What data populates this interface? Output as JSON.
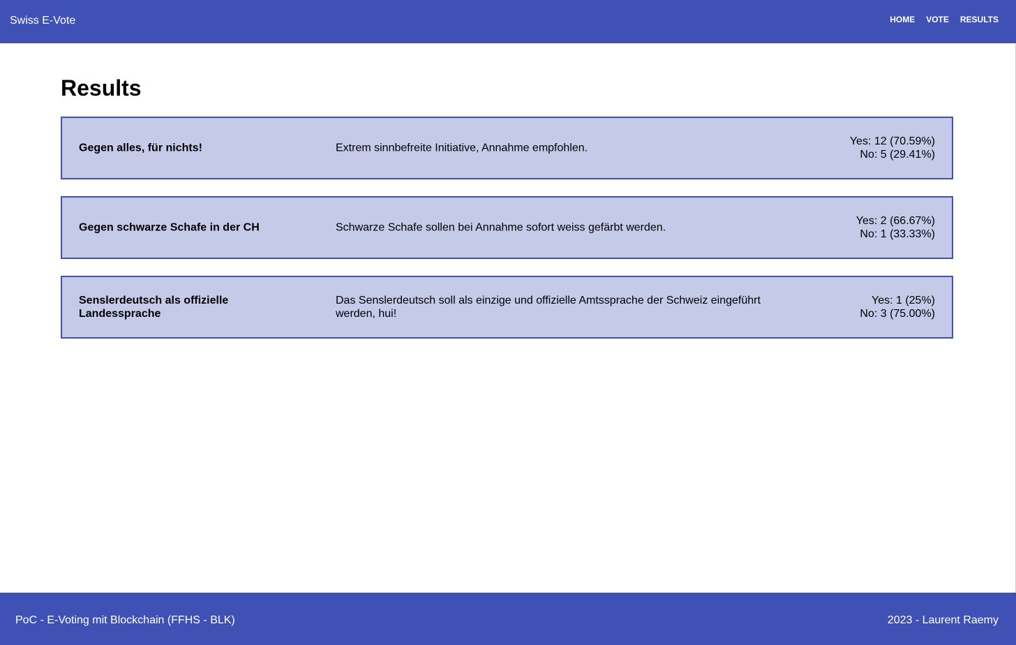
{
  "app": {
    "title": "Swiss E-Vote"
  },
  "nav": {
    "items": [
      {
        "label": "HOME"
      },
      {
        "label": "VOTE"
      },
      {
        "label": "RESULTS"
      }
    ]
  },
  "main": {
    "title": "Results",
    "results": [
      {
        "title": "Gegen alles, für nichts!",
        "description": "Extrem sinnbefreite Initiative, Annahme empfohlen.",
        "yes": "Yes: 12 (70.59%)",
        "no": "No: 5 (29.41%)"
      },
      {
        "title": "Gegen schwarze Schafe in der CH",
        "description": "Schwarze Schafe sollen bei Annahme sofort weiss gefärbt werden.",
        "yes": "Yes: 2 (66.67%)",
        "no": "No: 1 (33.33%)"
      },
      {
        "title": "Senslerdeutsch als offizielle Landessprache",
        "description": "Das Senslerdeutsch soll als einzige und offizielle Amtssprache der Schweiz eingeführt werden, hui!",
        "yes": "Yes: 1 (25%)",
        "no": "No: 3 (75.00%)"
      }
    ]
  },
  "footer": {
    "left": "PoC - E-Voting mit Blockchain (FFHS - BLK)",
    "right": "2023 - Laurent Raemy"
  },
  "colors": {
    "primary": "#3f51b5",
    "card_background": "#c5cae9",
    "text": "#000000",
    "header_text": "#ffffff"
  }
}
